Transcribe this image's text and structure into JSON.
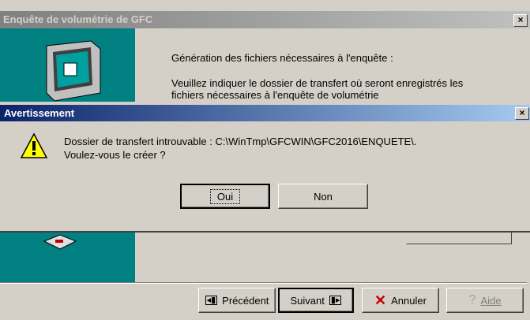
{
  "wizard": {
    "title": "Enquête de volumétrie de GFC",
    "heading": "Génération des fichiers nécessaires à l'enquête :",
    "instruction_line1": "Veuillez indiquer le dossier de transfert où seront enregistrés les",
    "instruction_line2": "fichiers nécessaires à l'enquête de volumétrie",
    "buttons": {
      "previous": "Précédent",
      "next": "Suivant",
      "cancel": "Annuler",
      "help": "Aide"
    }
  },
  "dialog": {
    "title": "Avertissement",
    "message_line1": "Dossier de transfert introuvable : C:\\WinTmp\\GFCWIN\\GFC2016\\ENQUETE\\.",
    "message_line2": "Voulez-vous le créer ?",
    "yes": "Oui",
    "no": "Non"
  },
  "colors": {
    "teal_panel": "#008080",
    "active_title": "#0a246a",
    "inactive_title": "#808080"
  }
}
